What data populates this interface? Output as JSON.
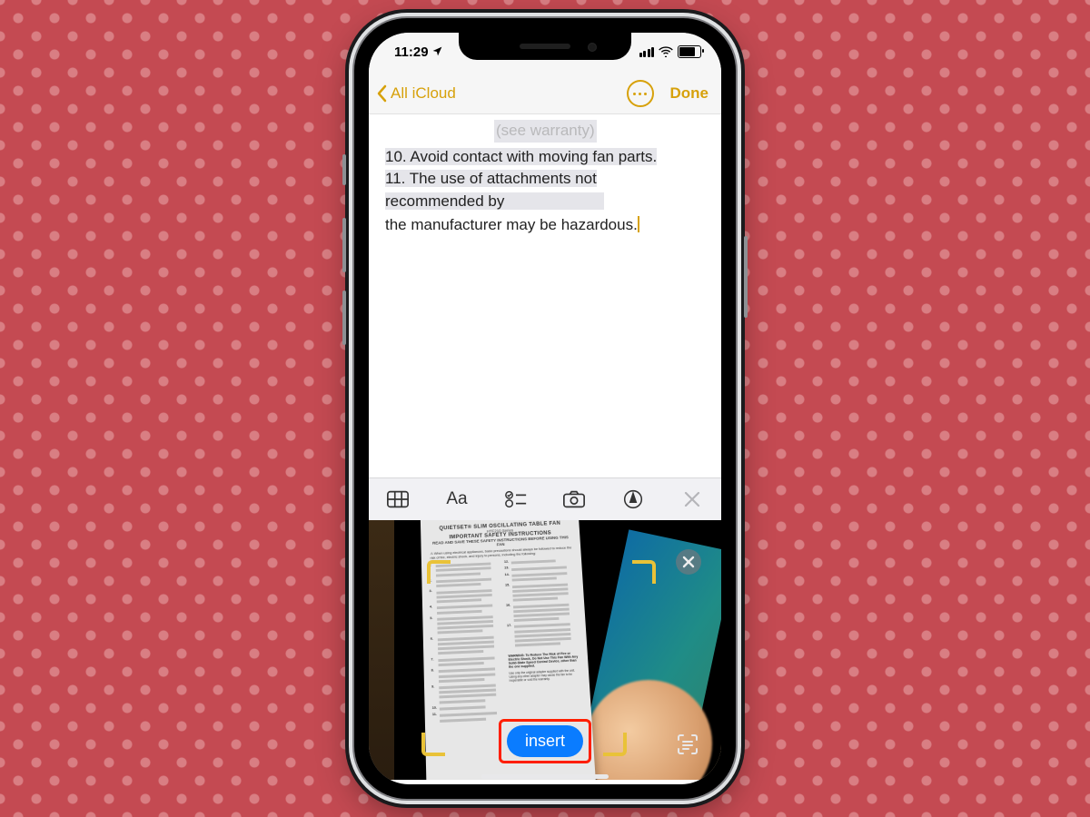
{
  "status": {
    "time": "11:29"
  },
  "nav": {
    "back_label": "All iCloud",
    "done_label": "Done"
  },
  "note": {
    "faded_tail": "(see warranty)",
    "line1": "10. Avoid contact with moving fan parts.",
    "line2a": "11. The use of attachments not",
    "line2b": "recommended by",
    "line3": "the manufacturer may be hazardous."
  },
  "toolbar": {
    "aa_label": "Aa"
  },
  "scan": {
    "insert_label": "insert",
    "doc_title1": "QUIETSET® SLIM OSCILLATING TABLE FAN",
    "doc_series": "HTF210 Series",
    "doc_title2": "IMPORTANT SAFETY INSTRUCTIONS",
    "doc_sub": "READ AND SAVE THESE SAFETY INSTRUCTIONS BEFORE USING THIS FAN",
    "doc_warn": "⚠ When using electrical appliances, basic precautions should always be followed to reduce the risk of fire, electric shock, and injury to persons, including the following:",
    "right_warn1": "WARNING: To Reduce The Risk of Fire or Electric Shock, Do Not Use This Fan With Any Solid-State Speed Control Device, other than the one supplied.",
    "right_warn2": "Use only the original adapter supplied with the unit. Using any other adapter may cause the fan to be inoperable or void the warranty."
  }
}
